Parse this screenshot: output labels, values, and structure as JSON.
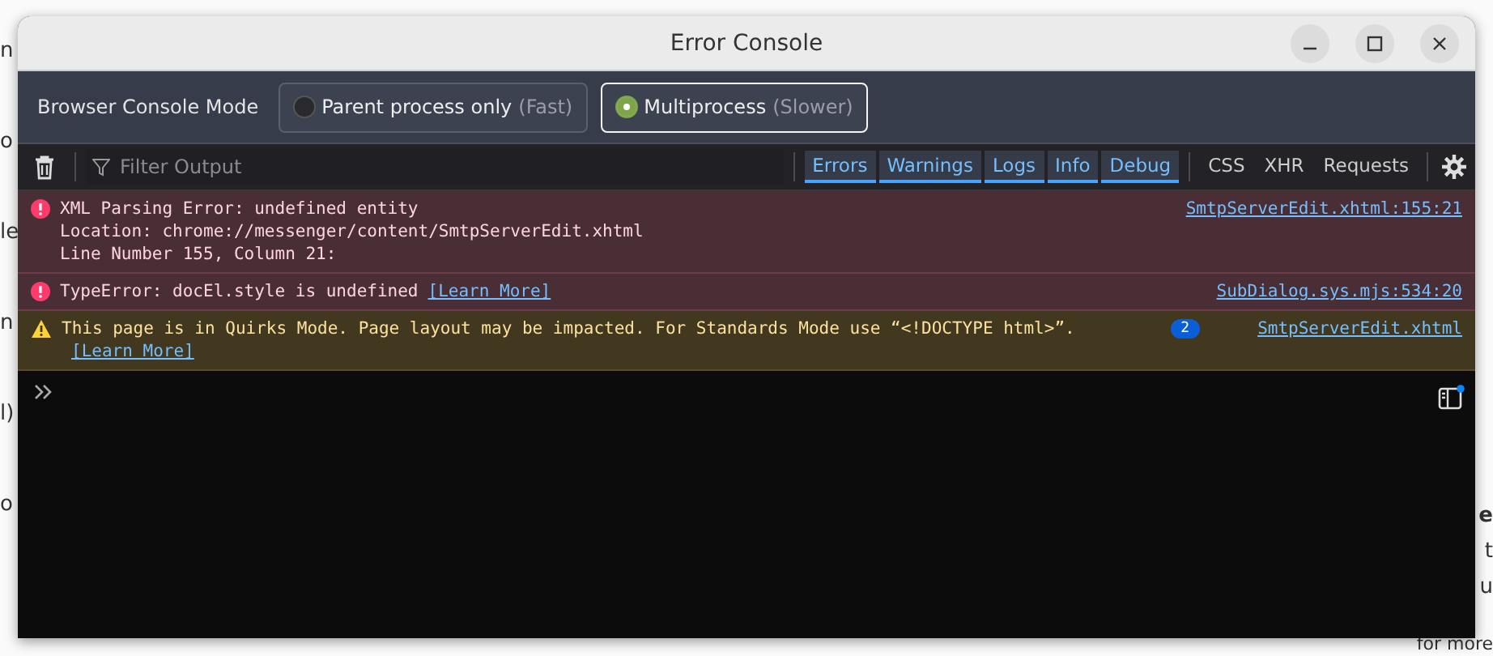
{
  "background_page": {
    "left_fragments": [
      "n",
      "o",
      "le",
      "n",
      "l)",
      "o"
    ],
    "right_fragments": [
      "e",
      "t",
      "u",
      "for more"
    ]
  },
  "window": {
    "title": "Error Console"
  },
  "mode_bar": {
    "label": "Browser Console Mode",
    "options": [
      {
        "label": "Parent process only",
        "note": "(Fast)",
        "selected": false
      },
      {
        "label": "Multiprocess",
        "note": "(Slower)",
        "selected": true
      }
    ]
  },
  "toolbar": {
    "filter": {
      "placeholder": "Filter Output"
    },
    "level_filters": [
      {
        "label": "Errors",
        "selected": true
      },
      {
        "label": "Warnings",
        "selected": true
      },
      {
        "label": "Logs",
        "selected": true
      },
      {
        "label": "Info",
        "selected": true
      },
      {
        "label": "Debug",
        "selected": true
      }
    ],
    "type_filters": [
      {
        "label": "CSS",
        "selected": false
      },
      {
        "label": "XHR",
        "selected": false
      },
      {
        "label": "Requests",
        "selected": false
      }
    ]
  },
  "messages": [
    {
      "kind": "error",
      "lines": [
        "XML Parsing Error: undefined entity",
        "Location: chrome://messenger/content/SmtpServerEdit.xhtml",
        "Line Number 155, Column 21:"
      ],
      "source": "SmtpServerEdit.xhtml:155:21"
    },
    {
      "kind": "error",
      "lines": [
        "TypeError: docEl.style is undefined"
      ],
      "learn_more": "[Learn More]",
      "source": "SubDialog.sys.mjs:534:20"
    },
    {
      "kind": "warning",
      "lines": [
        "This page is in Quirks Mode. Page layout may be impacted. For Standards Mode use “<!DOCTYPE html>”."
      ],
      "learn_more": "[Learn More]",
      "repeat": "2",
      "source": "SmtpServerEdit.xhtml"
    }
  ]
}
